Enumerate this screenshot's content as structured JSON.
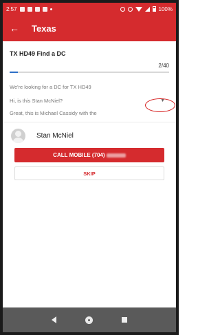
{
  "status_bar": {
    "time": "2:57",
    "battery": "100%"
  },
  "app_bar": {
    "title": "Texas"
  },
  "task": {
    "title": "TX HD49 Find a DC",
    "progress_text": "2/40",
    "progress_fraction": 0.05
  },
  "script": {
    "line1": "We're looking for a DC for TX HD49",
    "line2": "Hi, is this Stan McNiel?",
    "line3": "Great, this is Michael Cassidy with the"
  },
  "contact": {
    "name": "Stan McNiel",
    "call_label": "CALL MOBILE (704)",
    "skip_label": "SKIP"
  },
  "icons": {
    "back": "arrow-left",
    "dropdown": "caret-down",
    "avatar": "person-placeholder"
  },
  "colors": {
    "brand_red": "#d52b2e",
    "progress_blue": "#2d6fc6",
    "annotation_red": "#d62020"
  }
}
